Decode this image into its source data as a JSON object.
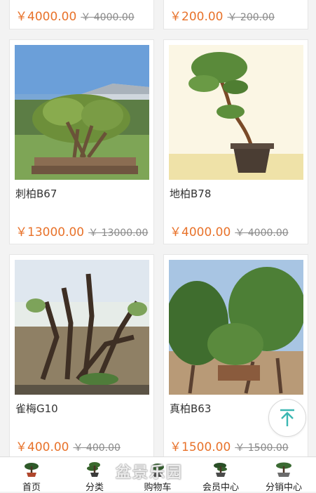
{
  "products": [
    {
      "name": "",
      "price": "￥4000.00",
      "old_price": "￥ 4000.00"
    },
    {
      "name": "",
      "price": "￥200.00",
      "old_price": "￥ 200.00"
    },
    {
      "name": "刺柏B67",
      "price": "￥13000.00",
      "old_price": "￥ 13000.00",
      "image": "bonsai-photo-juniper-greenhouse"
    },
    {
      "name": "地柏B78",
      "price": "￥4000.00",
      "old_price": "￥ 4000.00",
      "image": "bonsai-photo-pot-white-background"
    },
    {
      "name": "雀梅G10",
      "price": "￥400.00",
      "old_price": "￥ 400.00",
      "image": "bonsai-photo-stump-garden"
    },
    {
      "name": "真柏B63",
      "price": "￥1500.00",
      "old_price": "￥ 1500.00",
      "image": "bonsai-photo-field-trees"
    }
  ],
  "back_to_top_icon": "arrow-up-to-top-icon",
  "tabbar": {
    "items": [
      {
        "label": "首页",
        "icon": "bonsai-icon"
      },
      {
        "label": "分类",
        "icon": "bonsai-icon"
      },
      {
        "label": "购物车",
        "icon": "bonsai-icon"
      },
      {
        "label": "会员中心",
        "icon": "bonsai-icon"
      },
      {
        "label": "分销中心",
        "icon": "bonsai-icon"
      }
    ]
  },
  "watermark": "盆景乐园",
  "colors": {
    "price": "#e8722a",
    "accent": "#3bb7b2",
    "background": "#f3f3f3"
  }
}
